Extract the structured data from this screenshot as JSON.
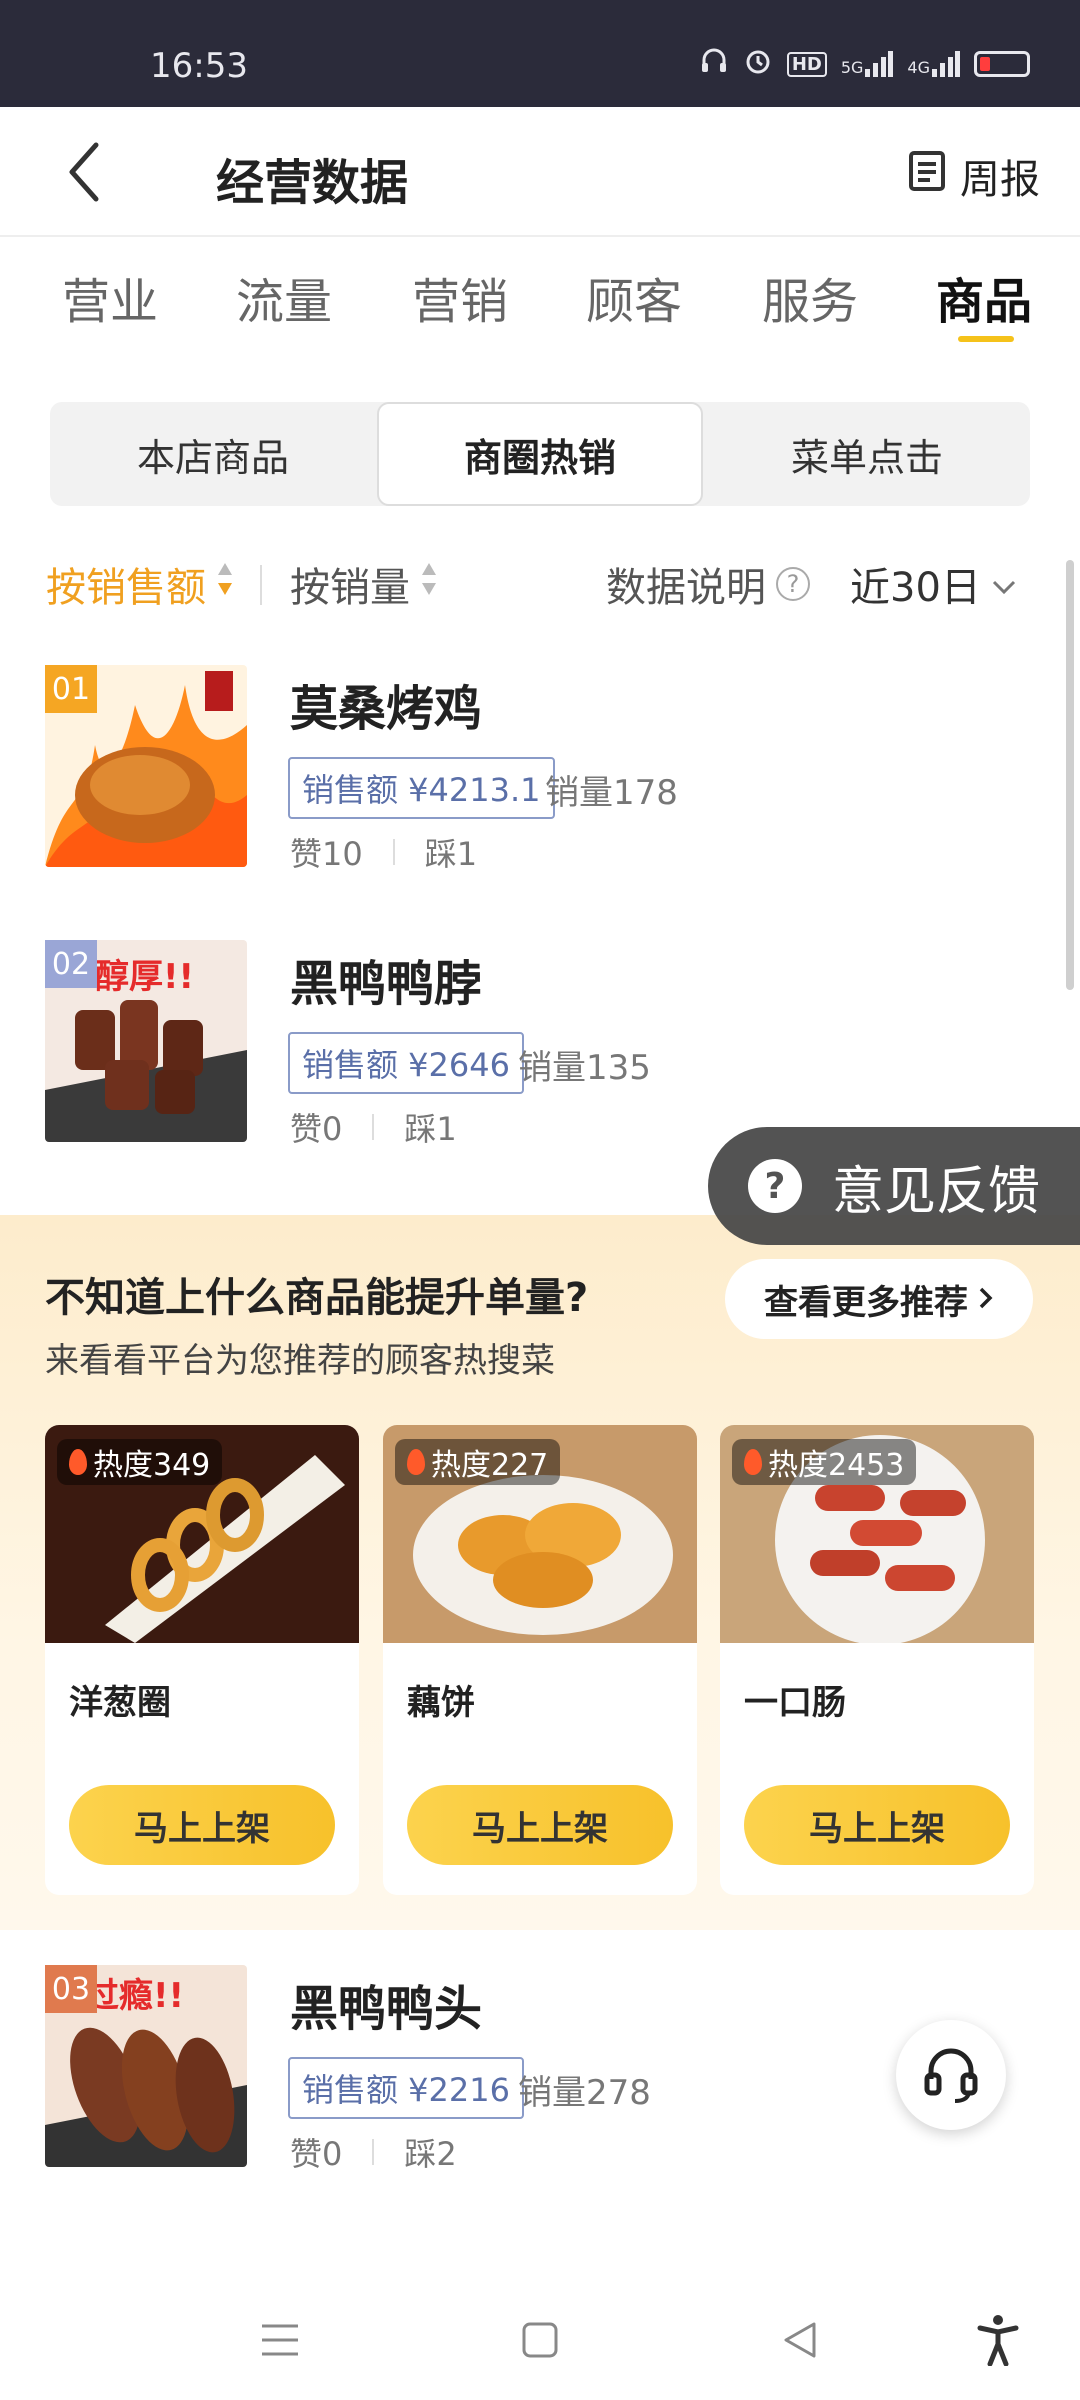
{
  "status_bar": {
    "time": "16:53",
    "icons": [
      "headset-icon",
      "alarm-icon",
      "hd-icon",
      "5g-signal-icon",
      "4g-signal-icon",
      "battery-low-icon"
    ],
    "network_labels": [
      "HD",
      "5G",
      "4G"
    ]
  },
  "header": {
    "title": "经营数据",
    "weekly_label": "周报"
  },
  "top_tabs": [
    {
      "label": "营业",
      "active": false
    },
    {
      "label": "流量",
      "active": false
    },
    {
      "label": "营销",
      "active": false
    },
    {
      "label": "顾客",
      "active": false
    },
    {
      "label": "服务",
      "active": false
    },
    {
      "label": "商品",
      "active": true
    }
  ],
  "segments": [
    {
      "label": "本店商品",
      "active": false
    },
    {
      "label": "商圈热销",
      "active": true
    },
    {
      "label": "菜单点击",
      "active": false
    }
  ],
  "sort": {
    "by_amount": "按销售额",
    "by_volume": "按销量",
    "data_note": "数据说明",
    "range": "近30日"
  },
  "products": [
    {
      "rank": "01",
      "name": "莫桑烤鸡",
      "sales": "销售额 ¥4213.1",
      "volume": "销量178",
      "likes": "赞10",
      "dislikes": "踩1",
      "badge_color": "#f5a623"
    },
    {
      "rank": "02",
      "name": "黑鸭鸭脖",
      "sales": "销售额 ¥2646",
      "volume": "销量135",
      "likes": "赞0",
      "dislikes": "踩1",
      "badge_color": "#9aa6d6"
    },
    {
      "rank": "03",
      "name": "黑鸭鸭头",
      "sales": "销售额 ¥2216",
      "volume": "销量278",
      "likes": "赞0",
      "dislikes": "踩2",
      "badge_color": "#e07a4e"
    }
  ],
  "feedback": {
    "label": "意见反馈"
  },
  "recommend": {
    "title": "不知道上什么商品能提升单量?",
    "subtitle": "来看看平台为您推荐的顾客热搜菜",
    "more_button": "查看更多推荐",
    "items": [
      {
        "heat": "热度349",
        "name": "洋葱圈",
        "button": "马上上架"
      },
      {
        "heat": "热度227",
        "name": "藕饼",
        "button": "马上上架"
      },
      {
        "heat": "热度2453",
        "name": "一口肠",
        "button": "马上上架"
      }
    ]
  },
  "colors": {
    "accent": "#f5c21a",
    "sort_active": "#f0a020",
    "sales_border": "#8a9bc8",
    "status_bar": "#2b2b3a"
  }
}
